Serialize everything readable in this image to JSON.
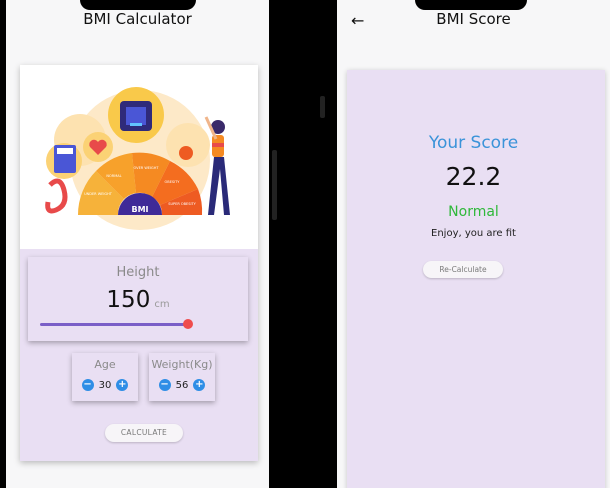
{
  "left": {
    "title": "BMI Calculator",
    "height": {
      "label": "Height",
      "value": "150",
      "unit": "cm",
      "slider_fraction": 0.78
    },
    "age": {
      "label": "Age",
      "value": "30"
    },
    "weight": {
      "label": "Weight(Kg)",
      "value": "56"
    },
    "calculate_label": "CALCULATE",
    "illustration": {
      "gauge_center": "BMI",
      "seg_normal": "NORMAL",
      "seg_over": "OVER WEIGHT",
      "seg_obesity": "OBESITY",
      "seg_super": "SUPER OBESITY",
      "seg_under": "UNDER WEIGHT"
    }
  },
  "right": {
    "title": "BMI Score",
    "your_score": "Your Score",
    "score": "22.2",
    "status": "Normal",
    "message": "Enjoy, you are fit",
    "recalculate_label": "Re-Calculate"
  },
  "colors": {
    "card": "#e9dff3",
    "accent": "#2f8ee6",
    "slider": "#7a5fc7",
    "thumb": "#ef4c4c",
    "score_blue": "#3a93d9",
    "normal_green": "#2fb83a"
  }
}
